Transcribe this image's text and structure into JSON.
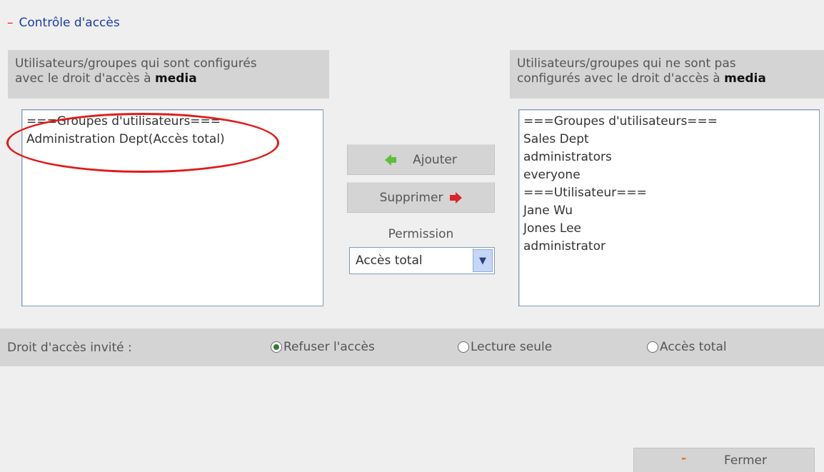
{
  "section": {
    "toggle": "–",
    "title": "Contrôle d'accès"
  },
  "left_panel": {
    "title_line1": "Utilisateurs/groupes qui sont configurés",
    "title_line2_prefix": "avec le droit d'accès à ",
    "title_bold": "media",
    "items": [
      "===Groupes d'utilisateurs===",
      "Administration Dept(Accès total)"
    ]
  },
  "right_panel": {
    "title_line1": "Utilisateurs/groupes qui ne sont pas",
    "title_line2_prefix": "configurés avec le droit d'accès à ",
    "title_bold": "media",
    "items": [
      "===Groupes d'utilisateurs===",
      "Sales Dept",
      "administrators",
      "everyone",
      "===Utilisateur===",
      "Jane Wu",
      "Jones Lee",
      "administrator"
    ]
  },
  "buttons": {
    "add": "Ajouter",
    "remove": "Supprimer",
    "close_icon": "-",
    "close": "Fermer"
  },
  "permission": {
    "label": "Permission",
    "selected": "Accès total",
    "dropdown_icon": "chevron-down-icon"
  },
  "guest": {
    "label": "Droit d'accès invité :",
    "options": [
      {
        "label": "Refuser l'accès",
        "checked": true
      },
      {
        "label": "Lecture seule",
        "checked": false
      },
      {
        "label": "Accès total",
        "checked": false
      }
    ]
  },
  "colors": {
    "header_link": "#1a3da8",
    "toggle": "#e02020",
    "add_arrow": "#5fbf3a",
    "remove_arrow": "#d92525",
    "annotation": "#e01b1b",
    "panel_bg": "#d4d4d4",
    "page_bg": "#efefef"
  }
}
